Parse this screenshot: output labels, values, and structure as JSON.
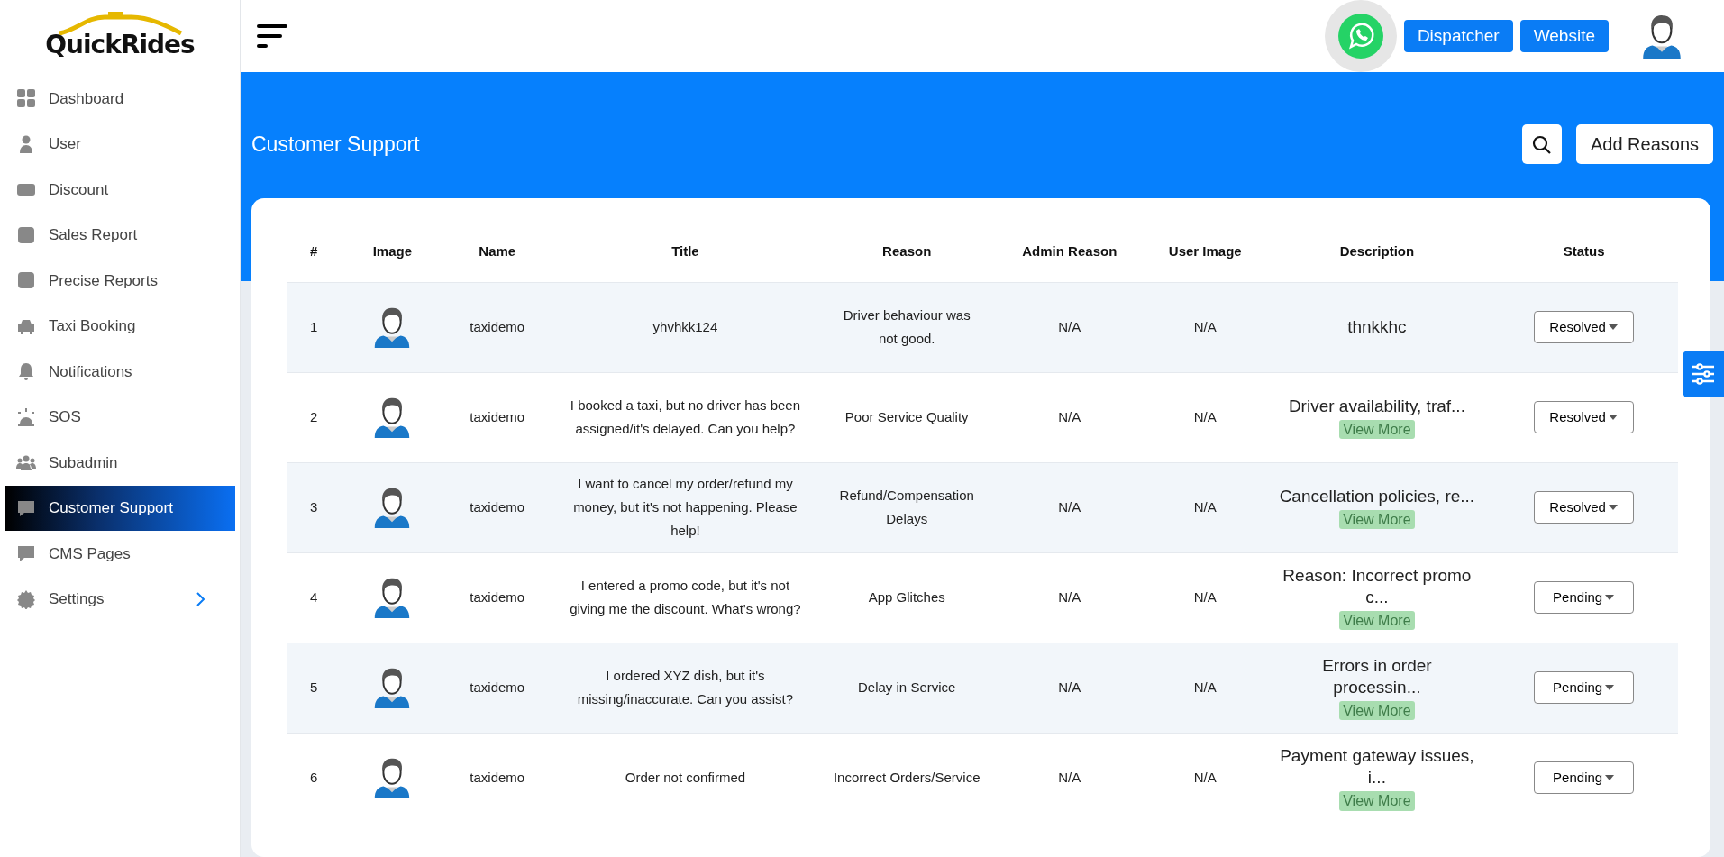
{
  "brand": {
    "logo": "QuickRides"
  },
  "sidebar": {
    "items": [
      {
        "label": "Dashboard",
        "selected": false
      },
      {
        "label": "User",
        "selected": false
      },
      {
        "label": "Discount",
        "selected": false
      },
      {
        "label": "Sales Report",
        "selected": false
      },
      {
        "label": "Precise Reports",
        "selected": false
      },
      {
        "label": "Taxi Booking",
        "selected": false
      },
      {
        "label": "Notifications",
        "selected": false
      },
      {
        "label": "SOS",
        "selected": false
      },
      {
        "label": "Subadmin",
        "selected": false
      },
      {
        "label": "Customer Support",
        "selected": true
      },
      {
        "label": "CMS Pages",
        "selected": false
      },
      {
        "label": "Settings",
        "selected": false,
        "expanded": false
      }
    ]
  },
  "topbar": {
    "buttons": [
      "Dispatcher",
      "Website"
    ]
  },
  "page": {
    "title": "Customer Support",
    "add_button": "Add Reasons"
  },
  "table": {
    "columns": [
      "#",
      "Image",
      "Name",
      "Title",
      "Reason",
      "Admin Reason",
      "User Image",
      "Description",
      "Status"
    ],
    "rows": [
      {
        "num": "1",
        "name": "taxidemo",
        "title": "yhvhkk124",
        "reason": "Driver behaviour was not good.",
        "admin_reason": "N/A",
        "user_image": "N/A",
        "description": "thnkkhc",
        "status": "Resolved"
      },
      {
        "num": "2",
        "name": "taxidemo",
        "title": "I booked a taxi, but no driver has been assigned/it's delayed. Can you help?",
        "reason": "Poor Service Quality",
        "admin_reason": "N/A",
        "user_image": "N/A",
        "description": "Driver availability, traf...",
        "more": "View More",
        "status": "Resolved"
      },
      {
        "num": "3",
        "name": "taxidemo",
        "title": "I want to cancel my order/refund my money, but it's not happening. Please help!",
        "reason": "Refund/Compensation Delays",
        "admin_reason": "N/A",
        "user_image": "N/A",
        "description": "Cancellation policies, re...",
        "more": "View More",
        "status": "Resolved"
      },
      {
        "num": "4",
        "name": "taxidemo",
        "title": "I entered a promo code, but it's not giving me the discount. What's wrong?",
        "reason": "App Glitches",
        "admin_reason": "N/A",
        "user_image": "N/A",
        "description": "Reason: Incorrect promo c...",
        "more": "View More",
        "status": "Pending"
      },
      {
        "num": "5",
        "name": "taxidemo",
        "title": "I ordered XYZ dish, but it's missing/inaccurate. Can you assist?",
        "reason": "Delay in Service",
        "admin_reason": "N/A",
        "user_image": "N/A",
        "description": "Errors in order processin...",
        "more": "View More",
        "status": "Pending"
      },
      {
        "num": "6",
        "name": "taxidemo",
        "title": "Order not confirmed",
        "reason": "Incorrect Orders/Service",
        "admin_reason": "N/A",
        "user_image": "N/A",
        "description": "Payment gateway issues, i...",
        "more": "View More",
        "status": "Pending"
      }
    ]
  }
}
